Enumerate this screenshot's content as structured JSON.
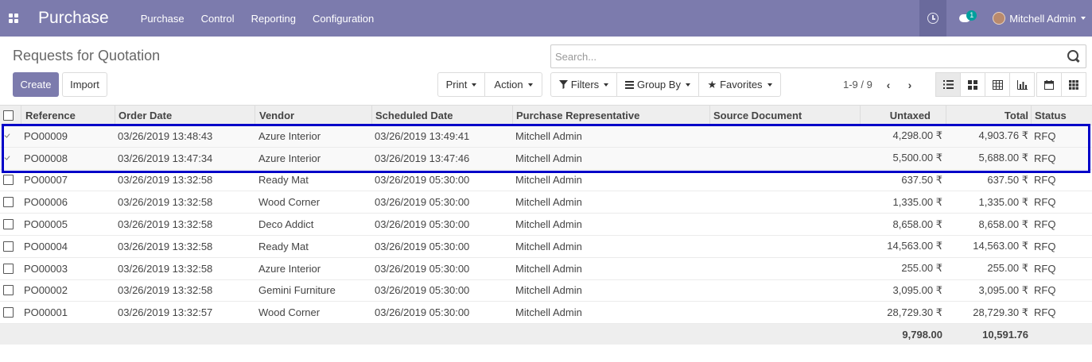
{
  "navbar": {
    "app_title": "Purchase",
    "menu": [
      "Purchase",
      "Control",
      "Reporting",
      "Configuration"
    ],
    "chat_badge": "1",
    "user_name": "Mitchell Admin"
  },
  "page": {
    "title": "Requests for Quotation",
    "create_label": "Create",
    "import_label": "Import",
    "search_placeholder": "Search...",
    "print_label": "Print",
    "action_label": "Action",
    "filters_label": "Filters",
    "groupby_label": "Group By",
    "favorites_label": "Favorites",
    "pager": "1-9 / 9"
  },
  "table": {
    "columns": [
      "Reference",
      "Order Date",
      "Vendor",
      "Scheduled Date",
      "Purchase Representative",
      "Source Document",
      "Untaxed",
      "Total",
      "Status"
    ],
    "rows": [
      {
        "selected": true,
        "ref": "PO00009",
        "order_date": "03/26/2019 13:48:43",
        "vendor": "Azure Interior",
        "scheduled": "03/26/2019 13:49:41",
        "rep": "Mitchell Admin",
        "source": "",
        "untaxed": "4,298.00 ₹",
        "total": "4,903.76 ₹",
        "status": "RFQ"
      },
      {
        "selected": true,
        "ref": "PO00008",
        "order_date": "03/26/2019 13:47:34",
        "vendor": "Azure Interior",
        "scheduled": "03/26/2019 13:47:46",
        "rep": "Mitchell Admin",
        "source": "",
        "untaxed": "5,500.00 ₹",
        "total": "5,688.00 ₹",
        "status": "RFQ"
      },
      {
        "selected": false,
        "ref": "PO00007",
        "order_date": "03/26/2019 13:32:58",
        "vendor": "Ready Mat",
        "scheduled": "03/26/2019 05:30:00",
        "rep": "Mitchell Admin",
        "source": "",
        "untaxed": "637.50 ₹",
        "total": "637.50 ₹",
        "status": "RFQ"
      },
      {
        "selected": false,
        "ref": "PO00006",
        "order_date": "03/26/2019 13:32:58",
        "vendor": "Wood Corner",
        "scheduled": "03/26/2019 05:30:00",
        "rep": "Mitchell Admin",
        "source": "",
        "untaxed": "1,335.00 ₹",
        "total": "1,335.00 ₹",
        "status": "RFQ"
      },
      {
        "selected": false,
        "ref": "PO00005",
        "order_date": "03/26/2019 13:32:58",
        "vendor": "Deco Addict",
        "scheduled": "03/26/2019 05:30:00",
        "rep": "Mitchell Admin",
        "source": "",
        "untaxed": "8,658.00 ₹",
        "total": "8,658.00 ₹",
        "status": "RFQ"
      },
      {
        "selected": false,
        "ref": "PO00004",
        "order_date": "03/26/2019 13:32:58",
        "vendor": "Ready Mat",
        "scheduled": "03/26/2019 05:30:00",
        "rep": "Mitchell Admin",
        "source": "",
        "untaxed": "14,563.00 ₹",
        "total": "14,563.00 ₹",
        "status": "RFQ"
      },
      {
        "selected": false,
        "ref": "PO00003",
        "order_date": "03/26/2019 13:32:58",
        "vendor": "Azure Interior",
        "scheduled": "03/26/2019 05:30:00",
        "rep": "Mitchell Admin",
        "source": "",
        "untaxed": "255.00 ₹",
        "total": "255.00 ₹",
        "status": "RFQ"
      },
      {
        "selected": false,
        "ref": "PO00002",
        "order_date": "03/26/2019 13:32:58",
        "vendor": "Gemini Furniture",
        "scheduled": "03/26/2019 05:30:00",
        "rep": "Mitchell Admin",
        "source": "",
        "untaxed": "3,095.00 ₹",
        "total": "3,095.00 ₹",
        "status": "RFQ"
      },
      {
        "selected": false,
        "ref": "PO00001",
        "order_date": "03/26/2019 13:32:57",
        "vendor": "Wood Corner",
        "scheduled": "03/26/2019 05:30:00",
        "rep": "Mitchell Admin",
        "source": "",
        "untaxed": "28,729.30 ₹",
        "total": "28,729.30 ₹",
        "status": "RFQ"
      }
    ],
    "footer": {
      "untaxed_sum": "9,798.00",
      "total_sum": "10,591.76"
    }
  },
  "colors": {
    "brand": "#7c7bad",
    "highlight": "#0000c8"
  }
}
